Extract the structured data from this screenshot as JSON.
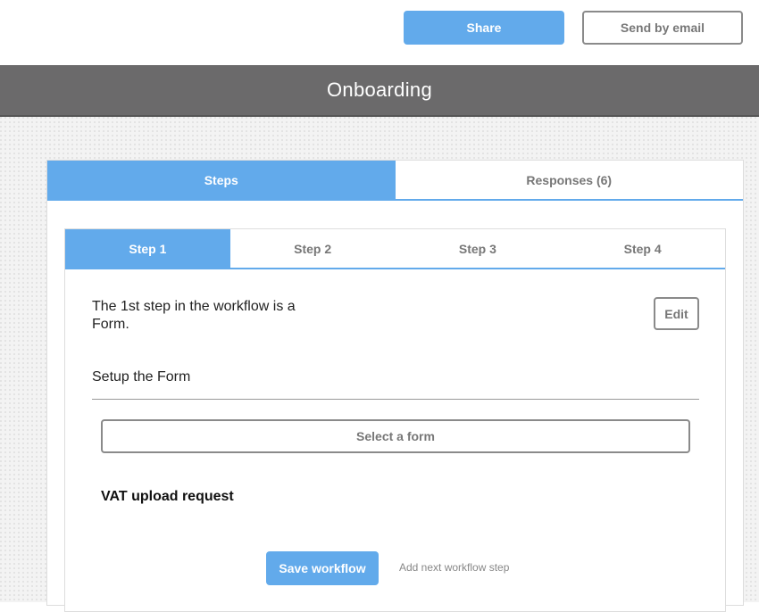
{
  "topbar": {
    "share_label": "Share",
    "email_label": "Send by email"
  },
  "header": {
    "title": "Onboarding"
  },
  "outer_tabs": [
    {
      "label": "Steps",
      "active": true
    },
    {
      "label": "Responses (6)",
      "active": false
    }
  ],
  "step_tabs": [
    {
      "label": "Step 1",
      "active": true
    },
    {
      "label": "Step 2",
      "active": false
    },
    {
      "label": "Step 3",
      "active": false
    },
    {
      "label": "Step 4",
      "active": false
    }
  ],
  "step": {
    "description": "The 1st step in the workflow is a Form.",
    "edit_label": "Edit",
    "setup_title": "Setup the Form",
    "select_label": "Select a form",
    "selected_form": "VAT upload request",
    "save_label": "Save workflow",
    "add_next_label": "Add next workflow step"
  },
  "colors": {
    "accent": "#62aaeb",
    "titlebar": "#6b6a6b"
  }
}
